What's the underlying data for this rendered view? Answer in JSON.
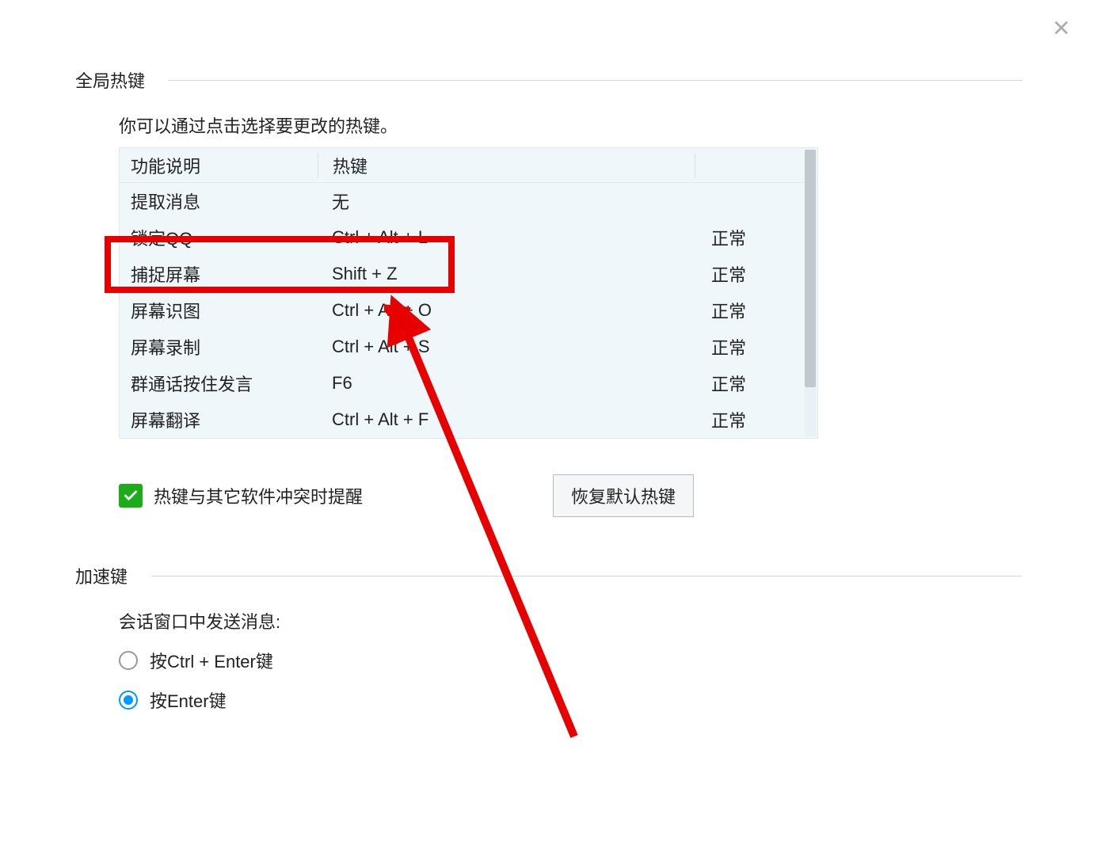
{
  "close_icon": "close",
  "global_hotkeys": {
    "title": "全局热键",
    "instruction": "你可以通过点击选择要更改的热键。",
    "columns": {
      "function": "功能说明",
      "hotkey": "热键",
      "status": ""
    },
    "rows": [
      {
        "function": "提取消息",
        "hotkey": "无",
        "status": ""
      },
      {
        "function": "锁定QQ",
        "hotkey": "Ctrl + Alt + L",
        "status": "正常"
      },
      {
        "function": "捕捉屏幕",
        "hotkey": "Shift + Z",
        "status": "正常"
      },
      {
        "function": "屏幕识图",
        "hotkey": "Ctrl + Alt + O",
        "status": "正常"
      },
      {
        "function": "屏幕录制",
        "hotkey": "Ctrl + Alt + S",
        "status": "正常"
      },
      {
        "function": "群通话按住发言",
        "hotkey": "F6",
        "status": "正常"
      },
      {
        "function": "屏幕翻译",
        "hotkey": "Ctrl + Alt + F",
        "status": "正常"
      }
    ],
    "conflict_checkbox_label": "热键与其它软件冲突时提醒",
    "restore_button": "恢复默认热键"
  },
  "accelerator": {
    "title": "加速键",
    "subtitle": "会话窗口中发送消息:",
    "options": [
      {
        "label": "按Ctrl + Enter键",
        "checked": false
      },
      {
        "label": "按Enter键",
        "checked": true
      }
    ]
  }
}
